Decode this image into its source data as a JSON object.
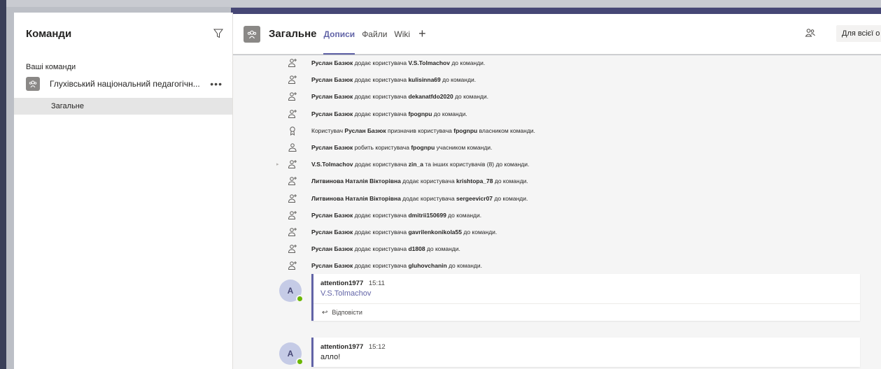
{
  "colors": {
    "accent": "#6264a7",
    "presence_available": "#6bb700",
    "header_dark": "#464775"
  },
  "teams_pane": {
    "title": "Команди",
    "filter_icon": "filter-icon",
    "section_label": "Ваші команди",
    "team": {
      "name": "Глухівський національний педагогічн...",
      "more": "•••",
      "icon": "team-icon"
    },
    "channel": "Загальне"
  },
  "channel_header": {
    "name": "Загальне",
    "tabs": [
      {
        "label": "Дописи",
        "active": true
      },
      {
        "label": "Файли",
        "active": false
      },
      {
        "label": "Wiki",
        "active": false
      }
    ],
    "add": "+",
    "meet_icon": "people-icon",
    "all_button": "Для всієї о"
  },
  "activity": [
    {
      "icon": "add-user",
      "actor": "Руслан Базюк",
      "verb": " додає користувача ",
      "target": "V.S.Tolmachov",
      "rest": " до команди."
    },
    {
      "icon": "add-user",
      "actor": "Руслан Базюк",
      "verb": " додає користувача ",
      "target": "kulisinna69",
      "rest": " до команди."
    },
    {
      "icon": "add-user",
      "actor": "Руслан Базюк",
      "verb": " додає користувача ",
      "target": "dekanatfdo2020",
      "rest": " до команди."
    },
    {
      "icon": "add-user",
      "actor": "Руслан Базюк",
      "verb": " додає користувача ",
      "target": "fpognpu",
      "rest": " до команди."
    },
    {
      "icon": "owner",
      "prefix": "Користувач ",
      "actor": "Руслан Базюк",
      "verb": " призначив користувача ",
      "target": "fpognpu",
      "rest": " власником команди."
    },
    {
      "icon": "member",
      "actor": "Руслан Базюк",
      "verb": " робить користувача ",
      "target": "fpognpu",
      "rest": " учасником команди."
    },
    {
      "icon": "add-user",
      "actor": "V.S.Tolmachov",
      "verb": " додає користувача ",
      "target": "zin_a",
      "rest": " та інших користувачів (8) до команди.",
      "expandable": true
    },
    {
      "icon": "add-user",
      "actor": "Литвинова Наталія Вікторівна",
      "verb": " додає користувача ",
      "target": "krishtopa_78",
      "rest": " до команди."
    },
    {
      "icon": "add-user",
      "actor": "Литвинова Наталія Вікторівна",
      "verb": " додає користувача ",
      "target": "sergeevicr07",
      "rest": " до команди."
    },
    {
      "icon": "add-user",
      "actor": "Руслан Базюк",
      "verb": " додає користувача ",
      "target": "dmitrii150699",
      "rest": " до команди."
    },
    {
      "icon": "add-user",
      "actor": "Руслан Базюк",
      "verb": " додає користувача ",
      "target": "gavrilenkonikola55",
      "rest": " до команди."
    },
    {
      "icon": "add-user",
      "actor": "Руслан Базюк",
      "verb": " додає користувача ",
      "target": "d1808",
      "rest": " до команди."
    },
    {
      "icon": "add-user",
      "actor": "Руслан Базюк",
      "verb": " додає користувача ",
      "target": "gluhovchanin",
      "rest": " до команди."
    }
  ],
  "messages": [
    {
      "avatar": "A",
      "author": "attention1977",
      "time": "15:11",
      "text": "V.S.Tolmachov",
      "is_link": true,
      "reply": "Відповісти"
    },
    {
      "avatar": "A",
      "author": "attention1977",
      "time": "15:12",
      "text": "алло!",
      "is_link": false
    }
  ]
}
